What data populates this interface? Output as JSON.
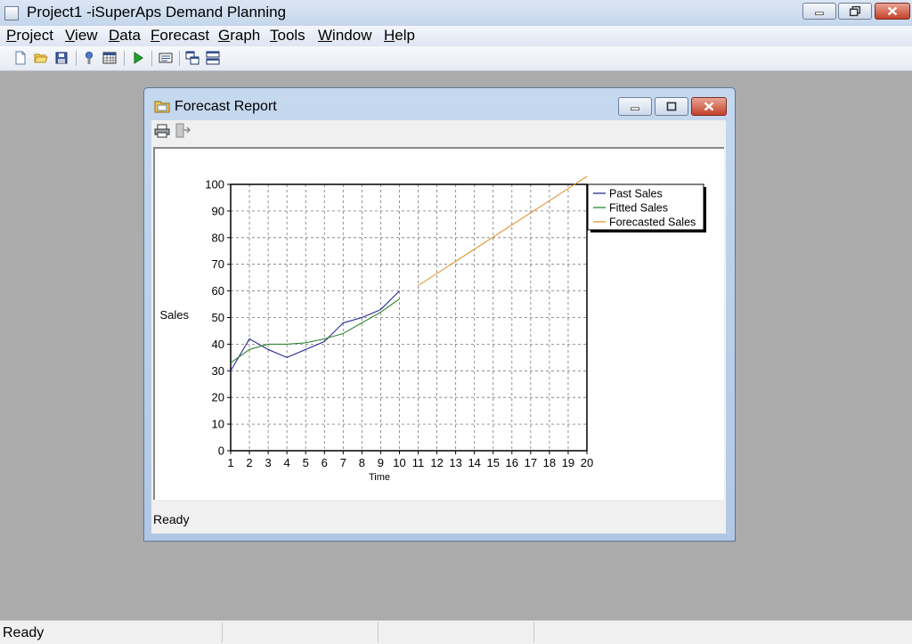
{
  "app": {
    "title": "Project1 -iSuperAps Demand Planning",
    "menu": [
      "Project",
      "View",
      "Data",
      "Forecast",
      "Graph",
      "Tools",
      "Window",
      "Help"
    ],
    "status": "Ready"
  },
  "report_window": {
    "title": "Forecast Report",
    "status": "Ready"
  },
  "colors": {
    "past": "#1a1a8c",
    "fitted": "#1f7a1f",
    "forecast": "#e08a1e"
  },
  "chart_data": {
    "type": "line",
    "xlabel": "Time",
    "ylabel": "Sales",
    "xlim": [
      1,
      20
    ],
    "ylim": [
      0,
      100
    ],
    "x_ticks": [
      1,
      2,
      3,
      4,
      5,
      6,
      7,
      8,
      9,
      10,
      11,
      12,
      13,
      14,
      15,
      16,
      17,
      18,
      19,
      20
    ],
    "y_ticks": [
      0,
      10,
      20,
      30,
      40,
      50,
      60,
      70,
      80,
      90,
      100
    ],
    "grid": true,
    "legend": "top-right",
    "series": [
      {
        "name": "Past Sales",
        "x": [
          1,
          2,
          3,
          4,
          5,
          6,
          7,
          8,
          9,
          10
        ],
        "y": [
          30,
          42,
          38,
          35,
          38,
          41,
          48,
          50,
          53,
          60
        ]
      },
      {
        "name": "Fitted Sales",
        "x": [
          1,
          2,
          3,
          4,
          5,
          6,
          7,
          8,
          9,
          10
        ],
        "y": [
          33,
          38,
          40,
          40,
          40.5,
          42,
          44,
          48,
          52,
          57
        ]
      },
      {
        "name": "Forecasted Sales",
        "x": [
          11,
          20
        ],
        "y": [
          62,
          103
        ]
      }
    ]
  }
}
